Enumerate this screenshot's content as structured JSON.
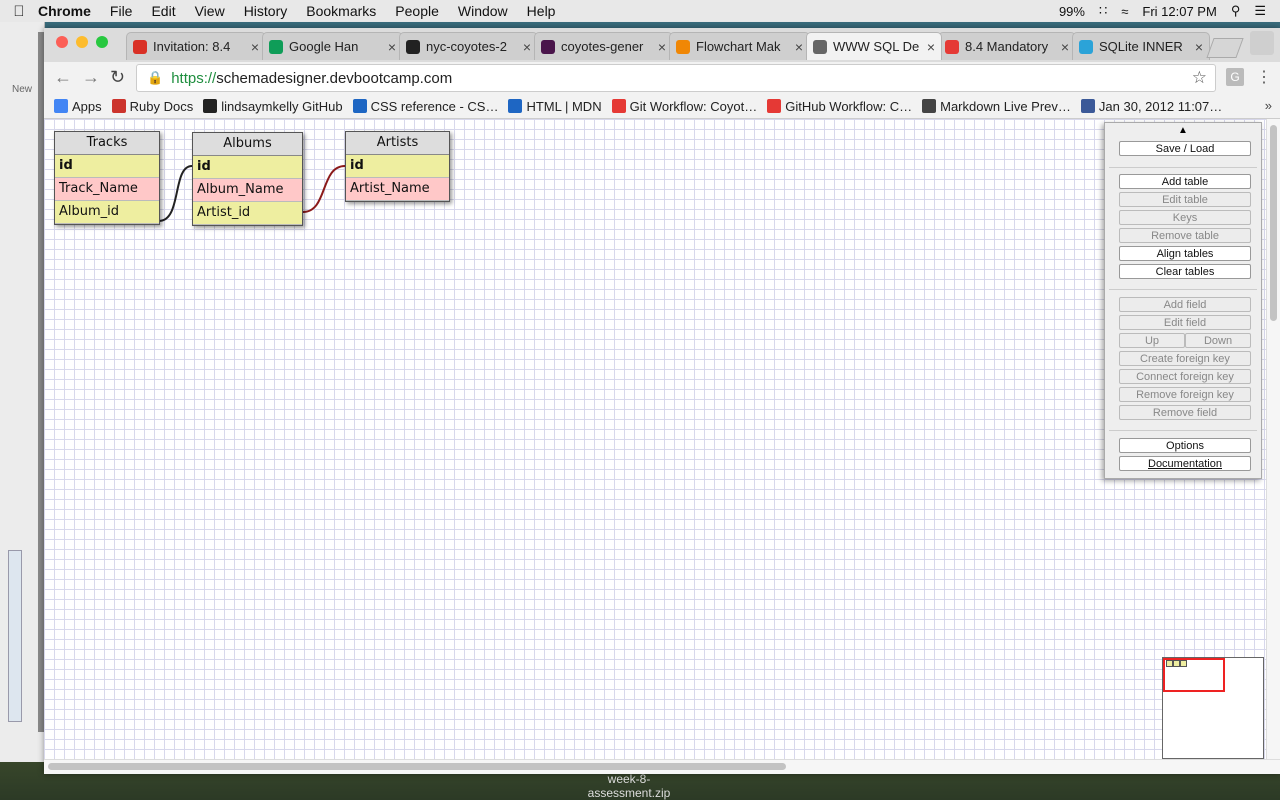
{
  "menubar": {
    "app": "Chrome",
    "items": [
      "File",
      "Edit",
      "View",
      "History",
      "Bookmarks",
      "People",
      "Window",
      "Help"
    ],
    "battery": "99%",
    "clock": "Fri 12:07 PM"
  },
  "tabs": [
    {
      "title": "Invitation: 8.4",
      "icon": "gmail-icon",
      "color": "#d93025"
    },
    {
      "title": "Google Han",
      "icon": "hangouts-icon",
      "color": "#0f9d58"
    },
    {
      "title": "nyc-coyotes-2",
      "icon": "github-icon",
      "color": "#222222"
    },
    {
      "title": "coyotes-gener",
      "icon": "slack-icon",
      "color": "#4a154b"
    },
    {
      "title": "Flowchart Mak",
      "icon": "flowchart-icon",
      "color": "#f08705"
    },
    {
      "title": "WWW SQL De",
      "icon": "page-icon",
      "color": "#666666",
      "active": true
    },
    {
      "title": "8.4 Mandatory",
      "icon": "devbootcamp-icon",
      "color": "#e53935"
    },
    {
      "title": "SQLite INNER",
      "icon": "sqlite-icon",
      "color": "#2ba3d8"
    }
  ],
  "address": {
    "scheme": "https://",
    "host": "schemadesigner.devbootcamp.com"
  },
  "bookmarks": [
    {
      "label": "Apps",
      "icon": "apps-grid-icon",
      "color": "#4285f4"
    },
    {
      "label": "Ruby Docs",
      "icon": "ruby-icon",
      "color": "#cc342d"
    },
    {
      "label": "lindsaymkelly GitHub",
      "icon": "github-icon",
      "color": "#222222"
    },
    {
      "label": "CSS reference - CS…",
      "icon": "mdn-icon",
      "color": "#1e66c3"
    },
    {
      "label": "HTML | MDN",
      "icon": "mdn-icon",
      "color": "#1e66c3"
    },
    {
      "label": "Git Workflow: Coyot…",
      "icon": "devbootcamp-icon",
      "color": "#e53935"
    },
    {
      "label": "GitHub Workflow: C…",
      "icon": "devbootcamp-icon",
      "color": "#e53935"
    },
    {
      "label": "Markdown Live Prev…",
      "icon": "markdown-icon",
      "color": "#444444"
    },
    {
      "label": "Jan 30, 2012 11:07…",
      "icon": "facebook-icon",
      "color": "#3b5998"
    }
  ],
  "schema": {
    "tables": [
      {
        "name": "Tracks",
        "fields": [
          {
            "name": "id",
            "kind": "key"
          },
          {
            "name": "Track_Name",
            "kind": "pink"
          },
          {
            "name": "Album_id",
            "kind": "plain"
          }
        ]
      },
      {
        "name": "Albums",
        "fields": [
          {
            "name": "id",
            "kind": "key"
          },
          {
            "name": "Album_Name",
            "kind": "pink"
          },
          {
            "name": "Artist_id",
            "kind": "plain"
          }
        ]
      },
      {
        "name": "Artists",
        "fields": [
          {
            "name": "id",
            "kind": "key"
          },
          {
            "name": "Artist_Name",
            "kind": "pink"
          }
        ]
      }
    ],
    "relations": [
      {
        "from": "Tracks.Album_id",
        "to": "Albums.id",
        "color": "#222222"
      },
      {
        "from": "Albums.Artist_id",
        "to": "Artists.id",
        "color": "#8b1a1a"
      }
    ]
  },
  "panel": {
    "save_load": "Save / Load",
    "add_table": "Add table",
    "edit_table": "Edit table",
    "keys": "Keys",
    "remove_table": "Remove table",
    "align_tables": "Align tables",
    "clear_tables": "Clear tables",
    "add_field": "Add field",
    "edit_field": "Edit field",
    "up": "Up",
    "down": "Down",
    "create_fk": "Create foreign key",
    "connect_fk": "Connect foreign key",
    "remove_fk": "Remove foreign key",
    "remove_field": "Remove field",
    "options": "Options",
    "documentation": "Documentation"
  },
  "desktop": {
    "file_label": "week-8-assessment.zip"
  },
  "left_window": {
    "new_label": "New"
  }
}
